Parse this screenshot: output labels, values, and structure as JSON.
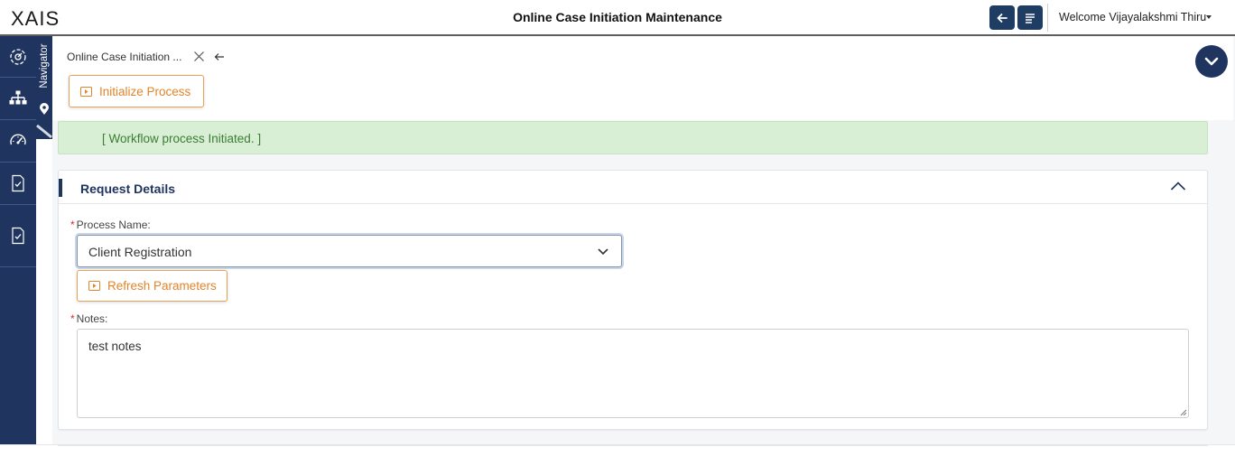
{
  "header": {
    "logo": "XAIS",
    "title": "Online Case Initiation Maintenance",
    "welcome": "Welcome Vijayalakshmi Thiru",
    "accent_color": "#1f3d63"
  },
  "sidebar": {
    "items": [
      {
        "icon": "dashboard-settings-icon"
      },
      {
        "icon": "sitemap-icon"
      },
      {
        "icon": "speedometer-icon"
      },
      {
        "icon": "document-check-icon"
      },
      {
        "icon": "document-check-icon"
      }
    ],
    "background": "#1f3560"
  },
  "navigator": {
    "label": "Navigator"
  },
  "tab": {
    "label": "Online Case Initiation ..."
  },
  "toolbar": {
    "initialize_label": "Initialize Process"
  },
  "alert": {
    "message": "[ Workflow process Initiated. ]",
    "color": "#d9efd5"
  },
  "request_details": {
    "title": "Request Details",
    "process_name": {
      "label": "Process Name:",
      "value": "Client Registration"
    },
    "refresh_label": "Refresh Parameters",
    "notes": {
      "label": "Notes:",
      "value": "test notes"
    }
  }
}
